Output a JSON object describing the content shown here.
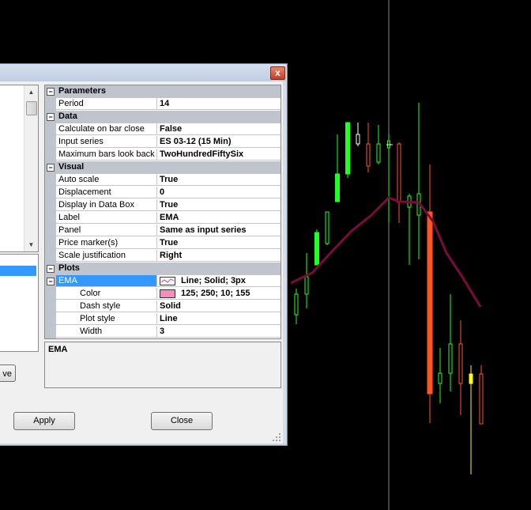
{
  "dialog": {
    "close_glyph": "x",
    "remove_button_label": "ve",
    "apply_label": "Apply",
    "close_label": "Close",
    "description": "EMA"
  },
  "grid": {
    "parameters": {
      "title": "Parameters",
      "period_label": "Period",
      "period_value": "14"
    },
    "data": {
      "title": "Data",
      "calc_label": "Calculate on bar close",
      "calc_value": "False",
      "input_label": "Input series",
      "input_value": "ES 03-12 (15 Min)",
      "maxbars_label": "Maximum bars look back",
      "maxbars_value": "TwoHundredFiftySix"
    },
    "visual": {
      "title": "Visual",
      "autoscale_label": "Auto scale",
      "autoscale_value": "True",
      "displacement_label": "Displacement",
      "displacement_value": "0",
      "databox_label": "Display in Data Box",
      "databox_value": "True",
      "label_label": "Label",
      "label_value": "EMA",
      "panel_label": "Panel",
      "panel_value": "Same as input series",
      "pricemarker_label": "Price marker(s)",
      "pricemarker_value": "True",
      "scalejust_label": "Scale justification",
      "scalejust_value": "Right"
    },
    "plots": {
      "title": "Plots",
      "ema_label": "EMA",
      "ema_value": "Line; Solid; 3px",
      "color_label": "Color",
      "color_value": "125; 250; 10; 155",
      "dash_label": "Dash style",
      "dash_value": "Solid",
      "plotstyle_label": "Plot style",
      "plotstyle_value": "Line",
      "width_label": "Width",
      "width_value": "3"
    }
  },
  "colors": {
    "up": "#22ff22",
    "down": "#ff5522",
    "ema_line": "#7d0a3c",
    "swatch": "#f58cc0",
    "crosshair": "#8a8a8a"
  },
  "icons": [
    "close-icon",
    "plot-preview-icon",
    "resize-grip-icon",
    "scroll-up-icon",
    "scroll-down-icon"
  ]
}
